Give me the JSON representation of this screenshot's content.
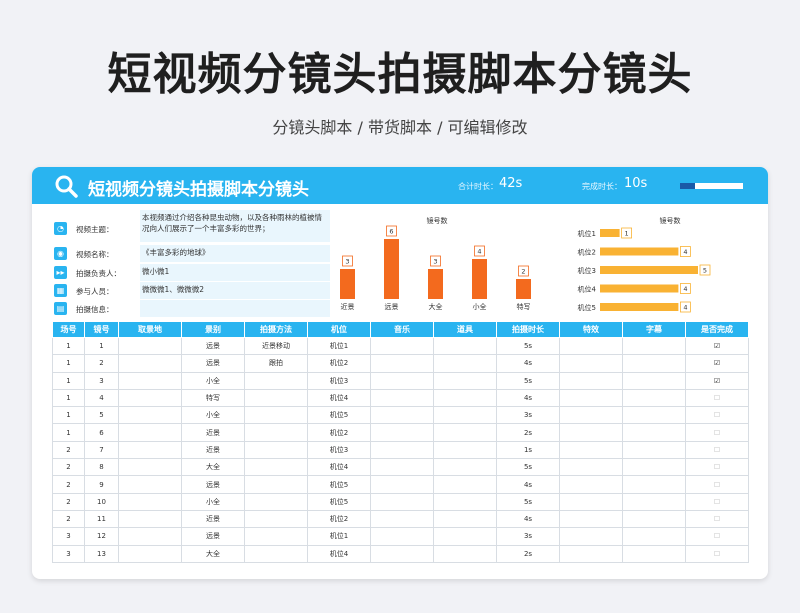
{
  "page": {
    "title": "短视频分镜头拍摄脚本分镜头",
    "subtitle": "分镜头脚本 / 带货脚本 / 可编辑修改"
  },
  "header": {
    "title": "短视频分镜头拍摄脚本分镜头",
    "total_label": "合计时长：",
    "total_value": "42s",
    "done_label": "完成时长：",
    "done_value": "10s",
    "progress": 0.24,
    "accent": "#29b4f0"
  },
  "info": [
    {
      "icon": "topic-icon",
      "label": "视频主题：",
      "value": "本视频通过介绍各种昆虫动物，以及各种雨林的植被情况向人们展示了一个丰富多彩的世界；"
    },
    {
      "icon": "name-icon",
      "label": "视频名称：",
      "value": "《丰富多彩的地球》"
    },
    {
      "icon": "person-icon",
      "label": "拍摄负责人：",
      "value": "微小微1"
    },
    {
      "icon": "people-icon",
      "label": "参与人员：",
      "value": "微微微1、微微微2"
    },
    {
      "icon": "folder-icon",
      "label": "拍摄信息：",
      "value": ""
    }
  ],
  "chart_data": [
    {
      "type": "bar",
      "title": "镜号数",
      "categories": [
        "近景",
        "远景",
        "大全",
        "小全",
        "特写"
      ],
      "values": [
        3,
        6,
        3,
        4,
        2
      ],
      "ylim": [
        0,
        6
      ],
      "color": "#f36a1e"
    },
    {
      "type": "bar",
      "orientation": "horizontal",
      "title": "镜号数",
      "categories": [
        "机位1",
        "机位2",
        "机位3",
        "机位4",
        "机位5"
      ],
      "values": [
        1,
        4,
        5,
        4,
        4
      ],
      "xlim": [
        0,
        5
      ],
      "color": "#f9b233"
    }
  ],
  "table": {
    "headers": [
      "场号",
      "镜号",
      "取景地",
      "景别",
      "拍摄方法",
      "机位",
      "音乐",
      "道具",
      "拍摄时长",
      "特效",
      "字幕",
      "是否完成"
    ],
    "rows": [
      {
        "scene": "1",
        "shot": "1",
        "location": "",
        "size": "远景",
        "method": "近景移动",
        "camera": "机位1",
        "music": "",
        "props": "",
        "duration": "5s",
        "fx": "",
        "caption": "",
        "done": "☑"
      },
      {
        "scene": "1",
        "shot": "2",
        "location": "",
        "size": "远景",
        "method": "跟拍",
        "camera": "机位2",
        "music": "",
        "props": "",
        "duration": "4s",
        "fx": "",
        "caption": "",
        "done": "☑"
      },
      {
        "scene": "1",
        "shot": "3",
        "location": "",
        "size": "小全",
        "method": "",
        "camera": "机位3",
        "music": "",
        "props": "",
        "duration": "5s",
        "fx": "",
        "caption": "",
        "done": "☑"
      },
      {
        "scene": "1",
        "shot": "4",
        "location": "",
        "size": "特写",
        "method": "",
        "camera": "机位4",
        "music": "",
        "props": "",
        "duration": "4s",
        "fx": "",
        "caption": "",
        "done": "☐"
      },
      {
        "scene": "1",
        "shot": "5",
        "location": "",
        "size": "小全",
        "method": "",
        "camera": "机位5",
        "music": "",
        "props": "",
        "duration": "3s",
        "fx": "",
        "caption": "",
        "done": "☐"
      },
      {
        "scene": "1",
        "shot": "6",
        "location": "",
        "size": "近景",
        "method": "",
        "camera": "机位2",
        "music": "",
        "props": "",
        "duration": "2s",
        "fx": "",
        "caption": "",
        "done": "☐"
      },
      {
        "scene": "2",
        "shot": "7",
        "location": "",
        "size": "近景",
        "method": "",
        "camera": "机位3",
        "music": "",
        "props": "",
        "duration": "1s",
        "fx": "",
        "caption": "",
        "done": "☐"
      },
      {
        "scene": "2",
        "shot": "8",
        "location": "",
        "size": "大全",
        "method": "",
        "camera": "机位4",
        "music": "",
        "props": "",
        "duration": "5s",
        "fx": "",
        "caption": "",
        "done": "☐"
      },
      {
        "scene": "2",
        "shot": "9",
        "location": "",
        "size": "远景",
        "method": "",
        "camera": "机位5",
        "music": "",
        "props": "",
        "duration": "4s",
        "fx": "",
        "caption": "",
        "done": "☐"
      },
      {
        "scene": "2",
        "shot": "10",
        "location": "",
        "size": "小全",
        "method": "",
        "camera": "机位5",
        "music": "",
        "props": "",
        "duration": "5s",
        "fx": "",
        "caption": "",
        "done": "☐"
      },
      {
        "scene": "2",
        "shot": "11",
        "location": "",
        "size": "近景",
        "method": "",
        "camera": "机位2",
        "music": "",
        "props": "",
        "duration": "4s",
        "fx": "",
        "caption": "",
        "done": "☐"
      },
      {
        "scene": "3",
        "shot": "12",
        "location": "",
        "size": "远景",
        "method": "",
        "camera": "机位1",
        "music": "",
        "props": "",
        "duration": "3s",
        "fx": "",
        "caption": "",
        "done": "☐"
      },
      {
        "scene": "3",
        "shot": "13",
        "location": "",
        "size": "大全",
        "method": "",
        "camera": "机位4",
        "music": "",
        "props": "",
        "duration": "2s",
        "fx": "",
        "caption": "",
        "done": "☐"
      }
    ]
  }
}
